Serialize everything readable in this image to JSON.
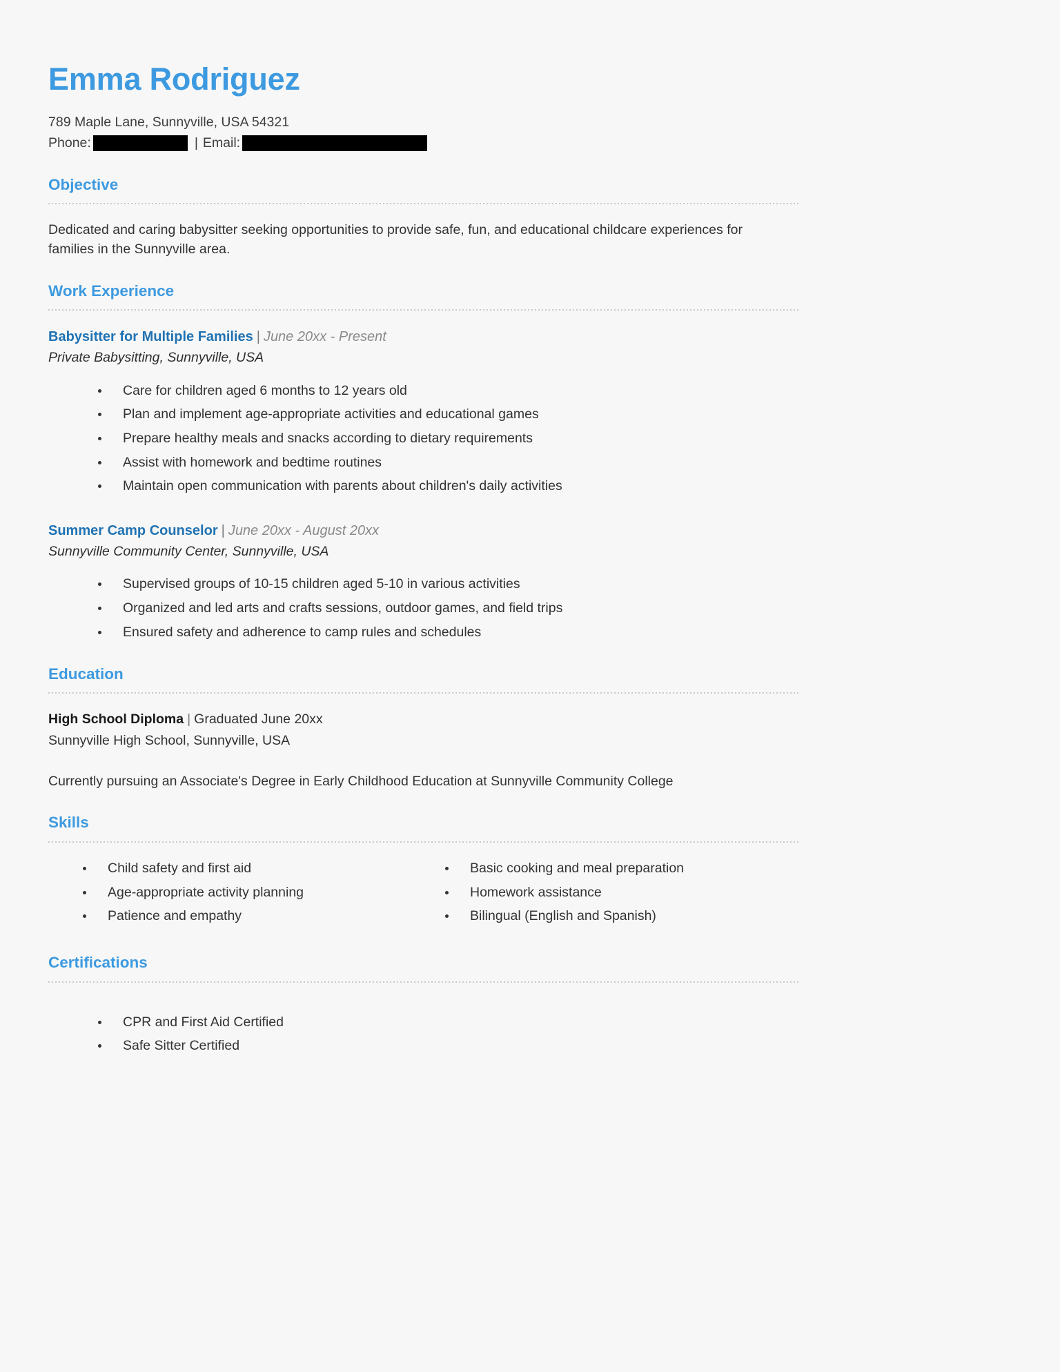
{
  "header": {
    "name": "Emma Rodriguez",
    "address": "789 Maple Lane, Sunnyville, USA 54321",
    "phone_label": "Phone:",
    "phone_value": "",
    "separator": "|",
    "email_label": "Email:",
    "email_value": "",
    "accent_color": "#3d9ae0"
  },
  "sections": {
    "objective": {
      "title": "Objective",
      "text": "Dedicated and caring babysitter seeking opportunities to provide safe, fun, and educational childcare experiences for families in the Sunnyville area."
    },
    "work_experience": {
      "title": "Work Experience",
      "jobs": [
        {
          "title": "Babysitter for Multiple Families",
          "pipe": "|",
          "dates": "June 20xx - Present",
          "org": "Private Babysitting, Sunnyville, USA",
          "bullets": [
            "Care for children aged 6 months to 12 years old",
            "Plan and implement age-appropriate activities and educational games",
            "Prepare healthy meals and snacks according to dietary requirements",
            "Assist with homework and bedtime routines",
            "Maintain open communication with parents about children's daily activities"
          ]
        },
        {
          "title": "Summer Camp Counselor",
          "pipe": "|",
          "dates": "June 20xx - August 20xx",
          "org": "Sunnyville Community Center, Sunnyville, USA",
          "bullets": [
            "Supervised groups of 10-15 children aged 5-10 in various activities",
            "Organized and led arts and crafts sessions, outdoor games, and field trips",
            "Ensured safety and adherence to camp rules and schedules"
          ]
        }
      ]
    },
    "education": {
      "title": "Education",
      "degree": "High School Diploma",
      "pipe": "|",
      "graduated": "Graduated June 20xx",
      "school": "Sunnyville High School, Sunnyville, USA",
      "note": "Currently pursuing an Associate's Degree in Early Childhood Education at Sunnyville Community College"
    },
    "skills": {
      "title": "Skills",
      "column_left": [
        "Child safety and first aid",
        "Age-appropriate activity planning",
        "Patience and empathy"
      ],
      "column_right": [
        "Basic cooking and meal preparation",
        "Homework assistance",
        "Bilingual (English and Spanish)"
      ]
    },
    "certifications": {
      "title": "Certifications",
      "items": [
        "CPR and First Aid Certified",
        "Safe Sitter Certified"
      ]
    }
  }
}
